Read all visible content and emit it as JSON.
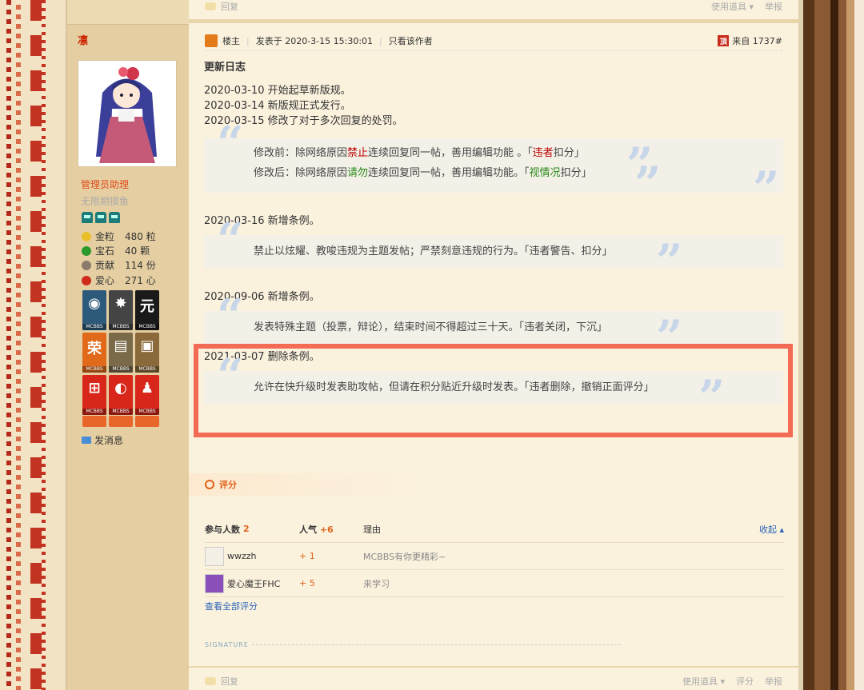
{
  "top_bar": {
    "reply": "回复",
    "use_item": "使用道具",
    "report": "举报"
  },
  "author": {
    "name": "凛",
    "group": "管理员助理",
    "subgroup": "无限期摸鱼",
    "stats": [
      {
        "label": "金粒",
        "value": "480 粒",
        "icon": "gold-nugget-icon",
        "color": "#e8c12a"
      },
      {
        "label": "宝石",
        "value": "40 颗",
        "icon": "emerald-icon",
        "color": "#2a9a2a"
      },
      {
        "label": "贡献",
        "value": "114 份",
        "icon": "contribution-icon",
        "color": "#8a7a6a"
      },
      {
        "label": "爱心",
        "value": "271 心",
        "icon": "heart-apple-icon",
        "color": "#d02a1a"
      }
    ],
    "medal_tag": "MCBBS",
    "send_message": "发消息"
  },
  "post": {
    "floor_label": "楼主",
    "posted_at": "发表于 2020-3-15 15:30:01",
    "only_author": "只看该作者",
    "source": "来自 1737#",
    "title": "更新日志",
    "log1": "2020-03-10 开始起草新版规。",
    "log2": "2020-03-14 新版规正式发行。",
    "log3": "2020-03-15 修改了对于多次回复的处罚。",
    "q1a_pre": "修改前：除网络原因",
    "q1a_red": "禁止",
    "q1a_mid": "连续回复同一帖，善用编辑功能 。「",
    "q1a_red2": "违者",
    "q1a_post": "扣分」",
    "q1b_pre": "修改后：除网络原因",
    "q1b_green": "请勿",
    "q1b_mid": "连续回复同一帖，善用编辑功能。「",
    "q1b_green2": "视情况",
    "q1b_post": "扣分」",
    "log4": "2020-03-16 新增条例。",
    "q2": "禁止以炫耀、教唆违规为主题发帖；严禁刻意违规的行为。「违者警告、扣分」",
    "log5": "2020-09-06 新增条例。",
    "q3": "发表特殊主题（投票，辩论），结束时间不得超过三十天。「违者关闭，下沉」",
    "log6": "2021-03-07 删除条例。",
    "q4": "允许在快升级时发表助攻帖，但请在积分贴近升级时发表。「违者删除，撤销正面评分」"
  },
  "rating": {
    "title": "评分",
    "col_participants": "参与人数",
    "participants": "2",
    "col_popularity": "人气",
    "popularity": "+6",
    "col_reason": "理由",
    "collapse": "收起",
    "rows": [
      {
        "user": "wwzzh",
        "score": "+ 1",
        "reason": "MCBBS有你更精彩~"
      },
      {
        "user": "爱心魔王FHC",
        "score": "+ 5",
        "reason": "来学习"
      }
    ],
    "view_all": "查看全部评分"
  },
  "signature_label": "SIGNATURE",
  "bottom_bar": {
    "reply": "回复",
    "use_item": "使用道具",
    "rate": "评分",
    "report": "举报"
  }
}
